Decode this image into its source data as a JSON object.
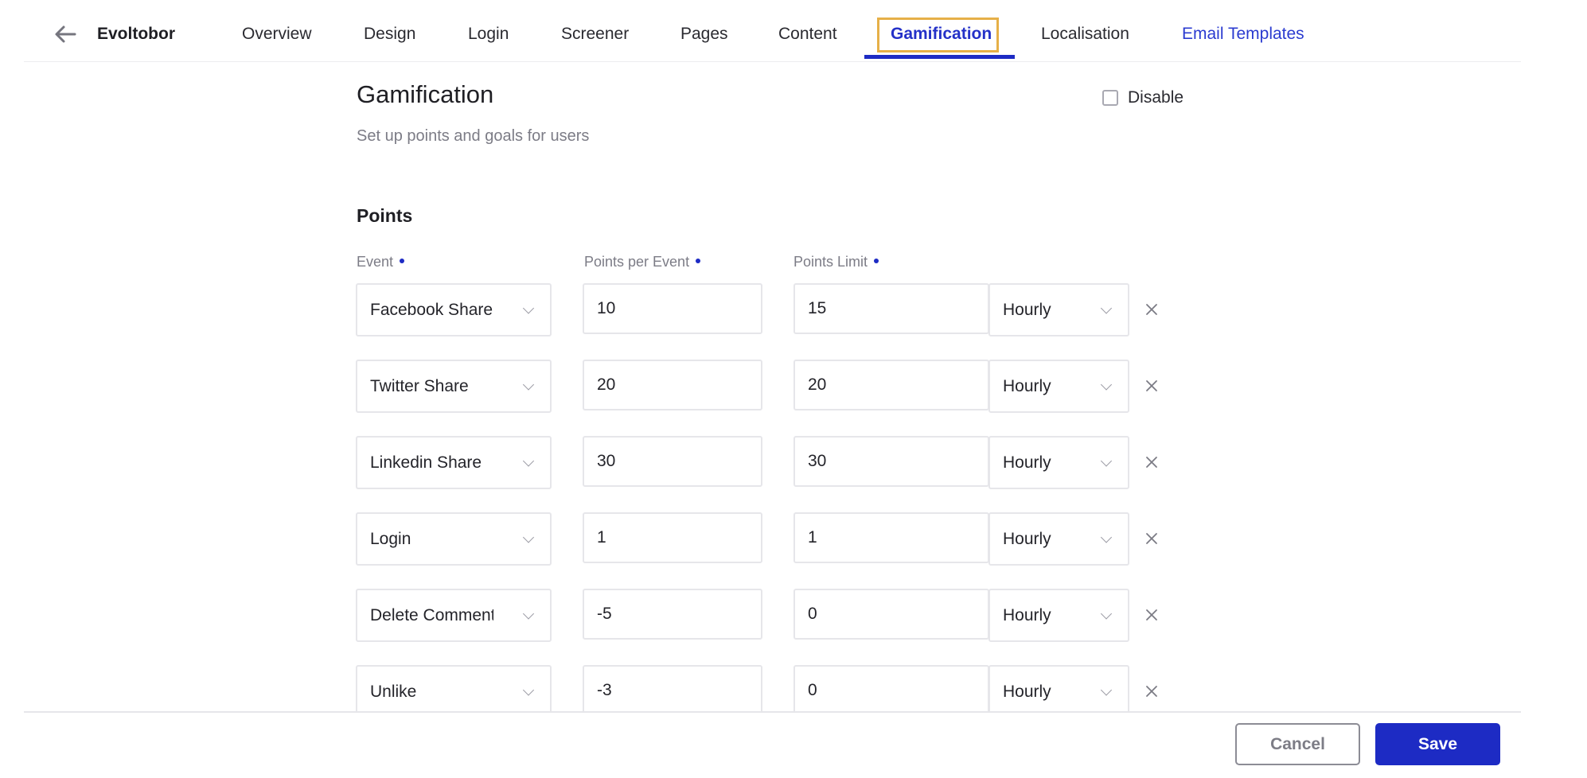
{
  "header": {
    "back_icon": "arrow-left-icon",
    "app_title": "Evoltobor",
    "tabs": [
      {
        "label": "Overview",
        "state": "default"
      },
      {
        "label": "Design",
        "state": "default"
      },
      {
        "label": "Login",
        "state": "default"
      },
      {
        "label": "Screener",
        "state": "default"
      },
      {
        "label": "Pages",
        "state": "default"
      },
      {
        "label": "Content",
        "state": "default"
      },
      {
        "label": "Gamification",
        "state": "active"
      },
      {
        "label": "Localisation",
        "state": "default"
      },
      {
        "label": "Email Templates",
        "state": "link"
      }
    ],
    "accent_color": "#1d2bc4",
    "focus_color": "#e6b048"
  },
  "page": {
    "title": "Gamification",
    "subtitle": "Set up points and goals for users",
    "disable_label": "Disable",
    "disable_checked": false
  },
  "points": {
    "section_title": "Points",
    "columns": {
      "event": "Event",
      "points_per_event": "Points per Event",
      "points_limit": "Points Limit"
    },
    "rows": [
      {
        "event": "Facebook Share",
        "points": "10",
        "limit": "15",
        "period": "Hourly"
      },
      {
        "event": "Twitter Share",
        "points": "20",
        "limit": "20",
        "period": "Hourly"
      },
      {
        "event": "Linkedin Share",
        "points": "30",
        "limit": "30",
        "period": "Hourly"
      },
      {
        "event": "Login",
        "points": "1",
        "limit": "1",
        "period": "Hourly"
      },
      {
        "event": "Delete Comment",
        "points": "-5",
        "limit": "0",
        "period": "Hourly"
      },
      {
        "event": "Unlike",
        "points": "-3",
        "limit": "0",
        "period": "Hourly"
      }
    ],
    "remove_icon": "close-icon"
  },
  "footer": {
    "cancel_label": "Cancel",
    "save_label": "Save"
  }
}
